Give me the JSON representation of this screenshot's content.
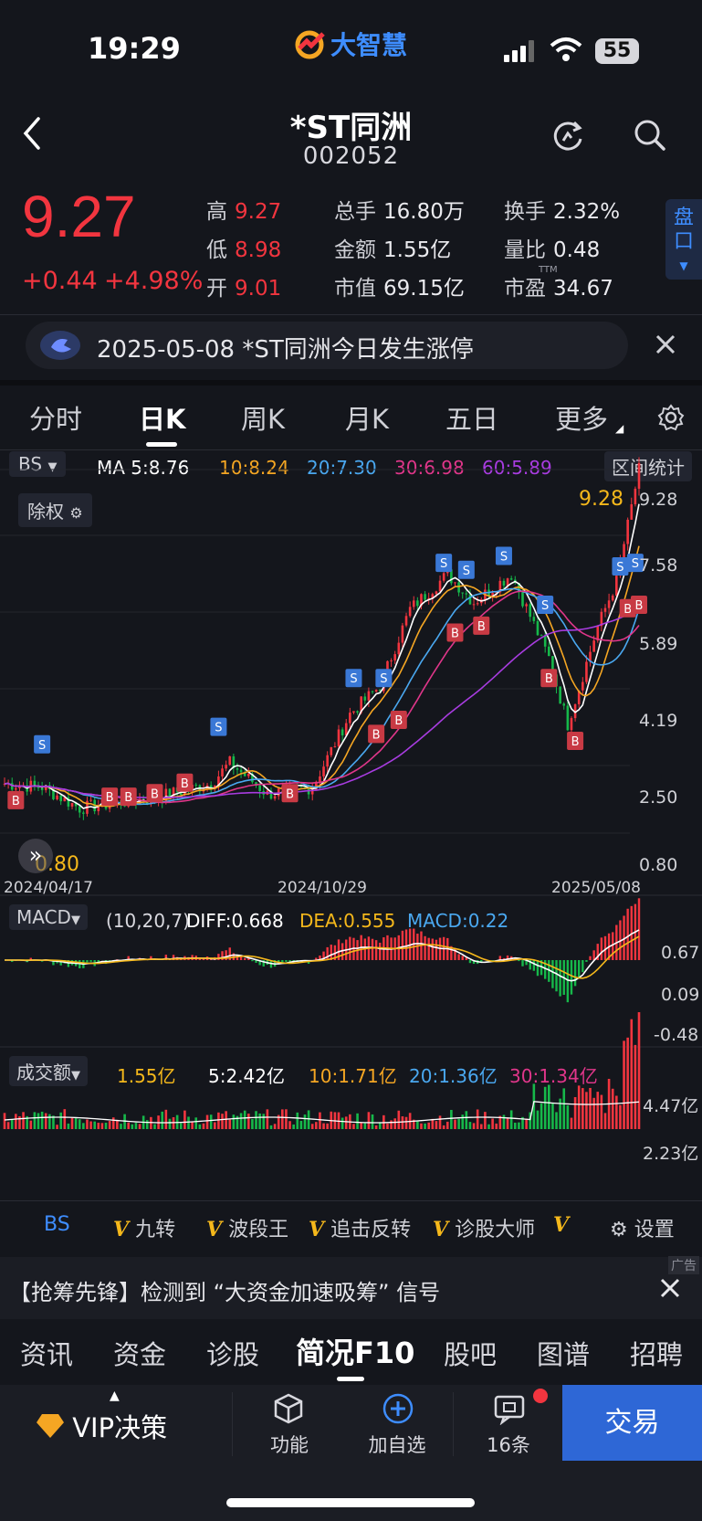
{
  "status_bar": {
    "time": "19:29",
    "battery": "55",
    "app_logo": "大智慧"
  },
  "header": {
    "name": "*ST同洲",
    "code": "002052"
  },
  "quote": {
    "price": "9.27",
    "change": "+0.44",
    "change_pct": "+4.98%",
    "high_label": "高",
    "high": "9.27",
    "low_label": "低",
    "low": "8.98",
    "open_label": "开",
    "open": "9.01",
    "volume_label": "总手",
    "volume": "16.80万",
    "amount_label": "金额",
    "amount": "1.55亿",
    "mcap_label": "市值",
    "mcap": "69.15亿",
    "turnover_label": "换手",
    "turnover": "2.32%",
    "vol_ratio_label": "量比",
    "vol_ratio": "0.48",
    "pe_label": "市盈",
    "pe_tag": "TTM",
    "pe": "34.67",
    "pankou": "盘口"
  },
  "notice": {
    "text": "2025-05-08 *ST同洲今日发生涨停"
  },
  "period_tabs": [
    "分时",
    "日K",
    "周K",
    "月K",
    "五日",
    "更多"
  ],
  "ma_legend": {
    "bs": "BS",
    "ma5": "MA 5:8.76",
    "ma10": "10:8.24",
    "ma20": "20:7.30",
    "ma30": "30:6.98",
    "ma60": "60:5.89",
    "range_stats": "区间统计"
  },
  "kline": {
    "exright": "除权",
    "max_label": "9.28",
    "min_label": "0.80",
    "y_ticks": [
      "9.28",
      "7.58",
      "5.89",
      "4.19",
      "2.50",
      "0.80"
    ],
    "x_ticks": [
      "2024/04/17",
      "2024/10/29",
      "2025/05/08"
    ]
  },
  "macd": {
    "name": "MACD",
    "params": "(10,20,7)",
    "diff": "DIFF:0.668",
    "dea": "DEA:0.555",
    "macd": "MACD:0.22",
    "y_ticks": [
      "0.67",
      "0.09",
      "-0.48"
    ]
  },
  "volume": {
    "name": "成交额",
    "current": "1.55亿",
    "m5": "5:2.42亿",
    "m10": "10:1.71亿",
    "m20": "20:1.36亿",
    "m30": "30:1.34亿",
    "y_ticks": [
      "4.47亿",
      "2.23亿"
    ]
  },
  "indicators": {
    "bs": "BS",
    "items": [
      "九转",
      "波段王",
      "追击反转",
      "诊股大师"
    ],
    "settings": "设置"
  },
  "ad": {
    "text": "【抢筹先锋】检测到 “大资金加速吸筹” 信号",
    "tag": "广告"
  },
  "bottom_tabs": [
    "资讯",
    "资金",
    "诊股",
    "简况F10",
    "股吧",
    "图谱",
    "招聘"
  ],
  "footer": {
    "vip": "VIP决策",
    "func": "功能",
    "add": "加自选",
    "msgs": "16条",
    "trade": "交易"
  },
  "colors": {
    "up": "#f2353f",
    "down": "#16b84a",
    "ma5": "#ffffff",
    "ma10": "#f5a623",
    "ma20": "#4aa8f0",
    "ma30": "#e0368a",
    "ma60": "#a83ce0",
    "accent": "#2e67d6"
  }
}
